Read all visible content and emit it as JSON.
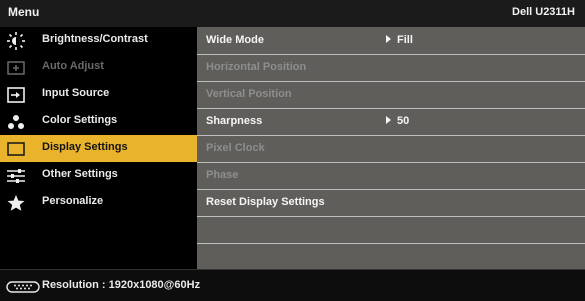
{
  "header": {
    "title": "Menu",
    "model": "Dell U2311H"
  },
  "menu": {
    "items": [
      {
        "label": "Brightness/Contrast",
        "icon": "brightness-icon",
        "state": "normal"
      },
      {
        "label": "Auto Adjust",
        "icon": "auto-adjust-icon",
        "state": "disabled"
      },
      {
        "label": "Input Source",
        "icon": "input-source-icon",
        "state": "normal"
      },
      {
        "label": "Color Settings",
        "icon": "color-settings-icon",
        "state": "normal"
      },
      {
        "label": "Display Settings",
        "icon": "display-settings-icon",
        "state": "selected"
      },
      {
        "label": "Other Settings",
        "icon": "other-settings-icon",
        "state": "normal"
      },
      {
        "label": "Personalize",
        "icon": "star-icon",
        "state": "normal"
      }
    ]
  },
  "display_settings": {
    "rows": [
      {
        "label": "Wide Mode",
        "value": "Fill",
        "state": "normal"
      },
      {
        "label": "Horizontal Position",
        "value": "",
        "state": "disabled"
      },
      {
        "label": "Vertical Position",
        "value": "",
        "state": "disabled"
      },
      {
        "label": "Sharpness",
        "value": "50",
        "state": "normal"
      },
      {
        "label": "Pixel Clock",
        "value": "",
        "state": "disabled"
      },
      {
        "label": "Phase",
        "value": "",
        "state": "disabled"
      },
      {
        "label": "Reset Display Settings",
        "value": "",
        "state": "normal"
      },
      {
        "label": "",
        "value": "",
        "state": "empty"
      }
    ]
  },
  "footer": {
    "resolution_label": "Resolution",
    "resolution_value": "1920x1080@60Hz",
    "resolution_text": "Resolution : 1920x1080@60Hz"
  },
  "colors": {
    "highlight": "#e9b32c",
    "panel": "#5f5e5a",
    "background": "#000000"
  }
}
